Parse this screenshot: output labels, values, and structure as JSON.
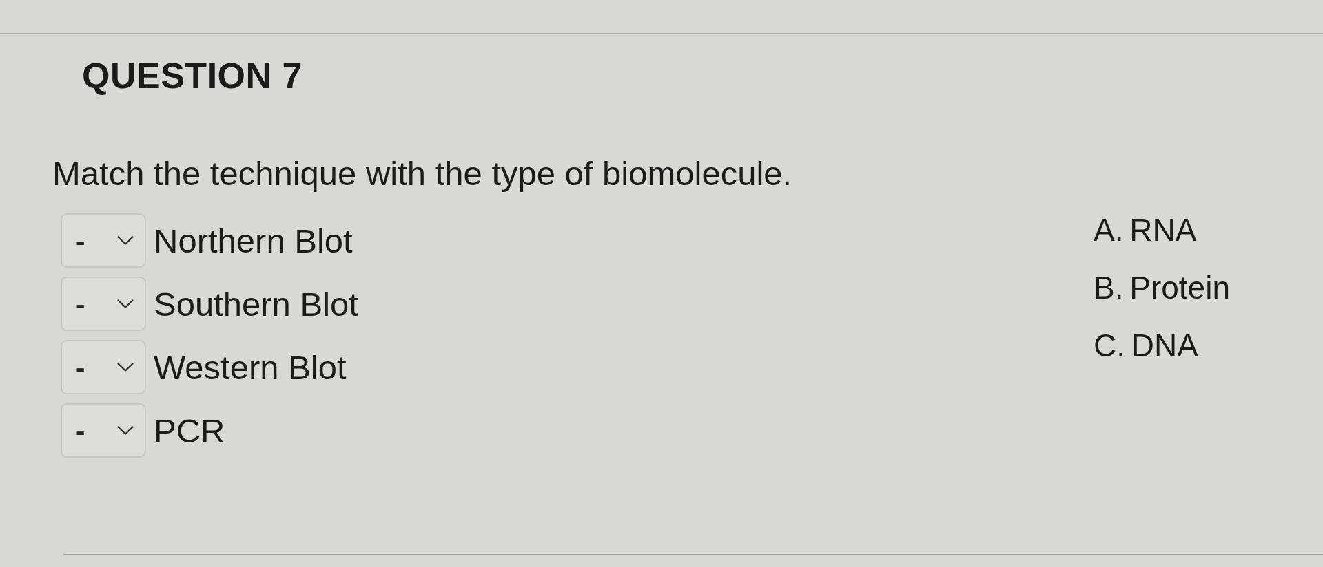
{
  "question": {
    "title": "QUESTION 7",
    "prompt": "Match the technique with the type of biomolecule."
  },
  "matches": [
    {
      "value": "-",
      "label": "Northern Blot"
    },
    {
      "value": "-",
      "label": "Southern Blot"
    },
    {
      "value": "-",
      "label": "Western Blot"
    },
    {
      "value": "-",
      "label": "PCR"
    }
  ],
  "answers": [
    "A. RNA",
    "B. Protein",
    "C. DNA"
  ]
}
